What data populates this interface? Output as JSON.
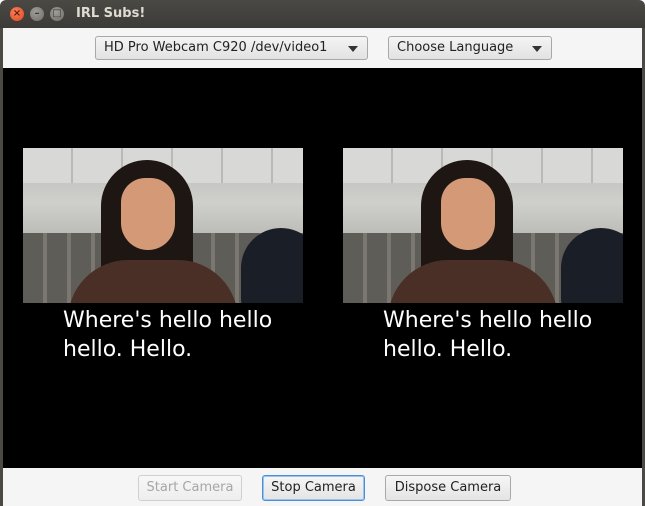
{
  "window": {
    "title": "IRL Subs!",
    "controls": {
      "close_glyph": "×",
      "minimize_glyph": "–",
      "maximize_glyph": "□"
    }
  },
  "toolbar": {
    "camera_select": {
      "value": "HD Pro Webcam C920 /dev/video1"
    },
    "language_select": {
      "value": "Choose Language"
    }
  },
  "video_panels": [
    {
      "subtitle": "Where's hello hello hello. Hello."
    },
    {
      "subtitle": "Where's hello hello hello. Hello."
    }
  ],
  "buttons": {
    "start_camera": "Start Camera",
    "stop_camera": "Stop Camera",
    "dispose_camera": "Dispose Camera"
  },
  "colors": {
    "titlebar": "#3c3b37",
    "close_button": "#e0471b",
    "video_background": "#000000",
    "subtitle_text": "#ffffff",
    "focus_ring": "#4a90d9"
  }
}
